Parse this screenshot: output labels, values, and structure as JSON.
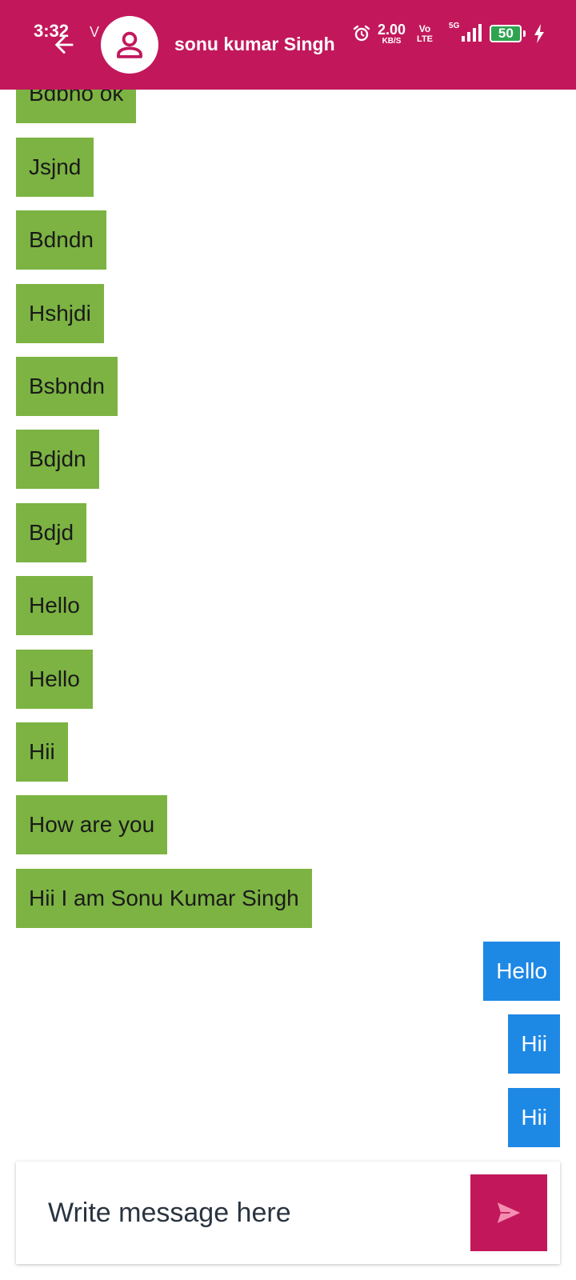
{
  "status_bar": {
    "time": "3:32",
    "v_icon": "V",
    "speed_value": "2.00",
    "speed_unit": "KB/S",
    "volte_top": "Vo",
    "volte_bottom": "LTE",
    "network_type": "5G",
    "battery": "50"
  },
  "header": {
    "contact_name": "sonu kumar Singh",
    "back_icon": "arrow-left-icon",
    "avatar_icon": "person-icon"
  },
  "messages": {
    "received": [
      "Bdbno ok",
      "Jsjnd",
      "Bdndn",
      "Hshjdi",
      "Bsbndn",
      "Bdjdn",
      "Bdjd",
      "Hello",
      "Hello",
      "Hii",
      "How are you",
      "Hii I am Sonu Kumar Singh"
    ],
    "sent": [
      "Hello",
      "Hii",
      "Hii"
    ]
  },
  "composer": {
    "placeholder": "Write message here",
    "value": "",
    "send_icon": "send-icon"
  },
  "colors": {
    "header": "#c2185b",
    "received_bubble": "#7cb342",
    "sent_bubble": "#1e88e5",
    "send_button": "#c2185b",
    "battery": "#2ea44f"
  }
}
